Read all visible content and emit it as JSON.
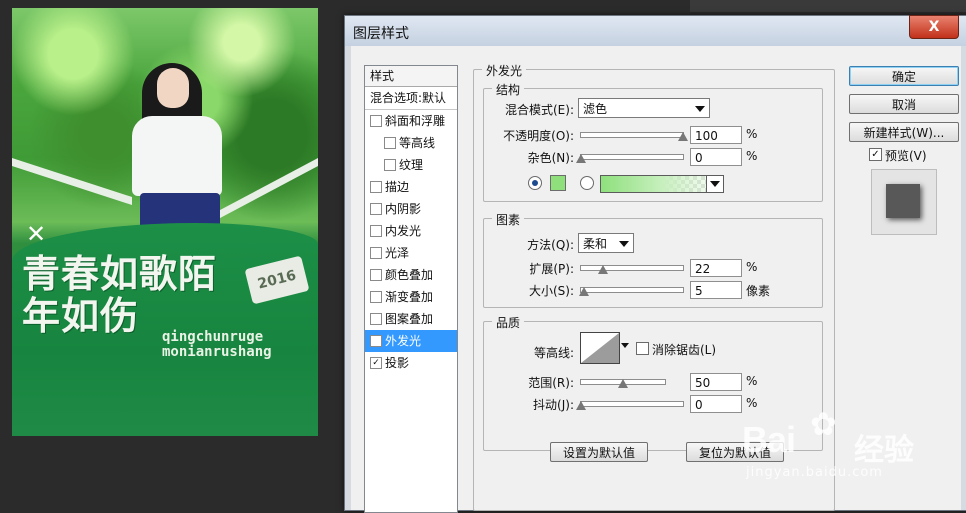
{
  "poster": {
    "title_line1": "青春如歌陌",
    "title_line2": "年如伤",
    "pinyin_line1": "qingchunruge",
    "pinyin_line2": "monianrushang",
    "badge": "2016"
  },
  "dialog": {
    "title": "图层样式",
    "close_label": "X"
  },
  "style_list": {
    "header": "样式",
    "blend": "混合选项:默认",
    "items": [
      {
        "label": "斜面和浮雕",
        "checked": false,
        "selected": false
      },
      {
        "label": "等高线",
        "checked": false,
        "selected": false
      },
      {
        "label": "纹理",
        "checked": false,
        "selected": false
      },
      {
        "label": "描边",
        "checked": false,
        "selected": false
      },
      {
        "label": "内阴影",
        "checked": false,
        "selected": false
      },
      {
        "label": "内发光",
        "checked": false,
        "selected": false
      },
      {
        "label": "光泽",
        "checked": false,
        "selected": false
      },
      {
        "label": "颜色叠加",
        "checked": false,
        "selected": false
      },
      {
        "label": "渐变叠加",
        "checked": false,
        "selected": false
      },
      {
        "label": "图案叠加",
        "checked": false,
        "selected": false
      },
      {
        "label": "外发光",
        "checked": true,
        "selected": true
      },
      {
        "label": "投影",
        "checked": true,
        "selected": false
      }
    ]
  },
  "outer_glow": {
    "title": "外发光",
    "structure": {
      "title": "结构",
      "blend_label": "混合模式(E):",
      "blend_value": "滤色",
      "opacity_label": "不透明度(O):",
      "opacity_value": "100",
      "opacity_unit": "%",
      "noise_label": "杂色(N):",
      "noise_value": "0",
      "noise_unit": "%",
      "color": "#8fe07d"
    },
    "elements": {
      "title": "图素",
      "method_label": "方法(Q):",
      "method_value": "柔和",
      "spread_label": "扩展(P):",
      "spread_value": "22",
      "spread_unit": "%",
      "size_label": "大小(S):",
      "size_value": "5",
      "size_unit": "像素"
    },
    "quality": {
      "title": "品质",
      "contour_label": "等高线:",
      "antialias_label": "消除锯齿(L)",
      "antialias_checked": false,
      "range_label": "范围(R):",
      "range_value": "50",
      "range_unit": "%",
      "jitter_label": "抖动(J):",
      "jitter_value": "0",
      "jitter_unit": "%"
    },
    "set_default_label": "设置为默认值",
    "reset_default_label": "复位为默认值"
  },
  "buttons": {
    "ok": "确定",
    "cancel": "取消",
    "new_style": "新建样式(W)...",
    "preview_label": "预览(V)",
    "preview_checked": true
  },
  "watermark": {
    "brand": "Bai",
    "cn": "经验",
    "url": "jingyan.baidu.com"
  }
}
